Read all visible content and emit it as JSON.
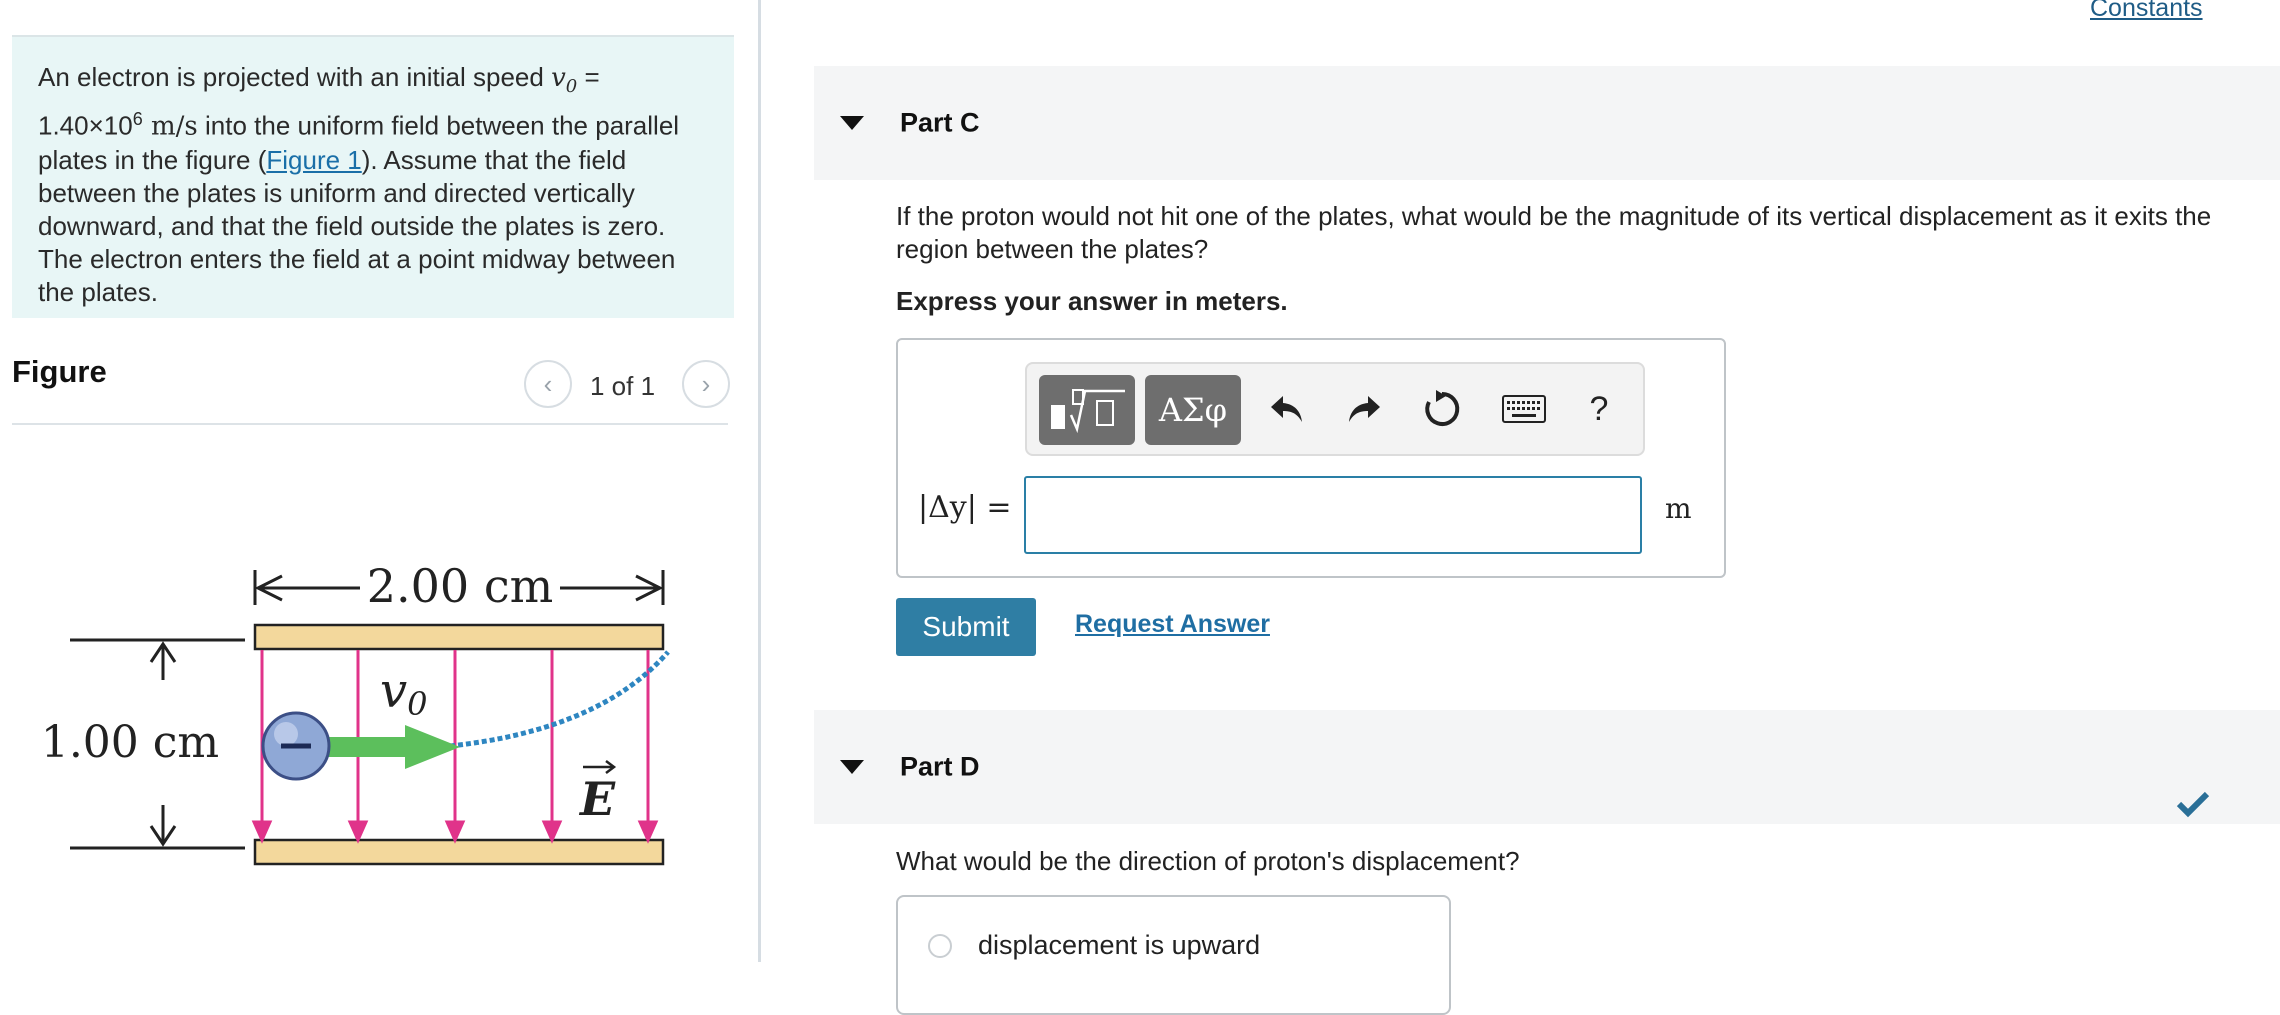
{
  "problem": {
    "text_a": "An electron is projected with an initial speed ",
    "v0_symbol": "v",
    "v0_sub": "0",
    "text_b": " = 1.40×10",
    "exp": "6",
    "unit": " m/s",
    "text_c": " into the uniform field between the parallel plates in the figure (",
    "figure_link": "Figure 1",
    "text_d": "). Assume that the field between the plates is uniform and directed vertically downward, and that the field outside the plates is zero. The electron enters the field at a point midway between the plates."
  },
  "figure": {
    "title": "Figure",
    "page_count": "1 of 1",
    "prev_icon": "chevron-left-icon",
    "next_icon": "chevron-right-icon",
    "length_label": "2.00 cm",
    "gap_label": "1.00 cm",
    "velocity_symbol": "v",
    "velocity_sub": "0",
    "field_symbol": "E",
    "colors": {
      "plate": "#f3d89c",
      "field": "#e0338a",
      "velocity": "#5cbf5c",
      "path": "#2e86c1",
      "charge": "#8fa8d6"
    }
  },
  "header": {
    "constants_link": "Constants"
  },
  "part_c": {
    "title": "Part C",
    "question": "If the proton would not hit one of the plates, what would be the magnitude of its vertical displacement as it exits the region between the plates?",
    "instruction": "Express your answer in meters.",
    "variable_label": "|Δy| =",
    "input_value": "",
    "unit": "m",
    "toolbar": {
      "templates_icon": "fraction-root-template-icon",
      "greek_label": "ΑΣφ",
      "undo_icon": "undo-icon",
      "redo_icon": "redo-icon",
      "reset_icon": "reset-icon",
      "keyboard_icon": "keyboard-icon",
      "help_label": "?"
    },
    "submit_label": "Submit",
    "request_label": "Request Answer"
  },
  "part_d": {
    "title": "Part D",
    "question": "What would be the direction of proton's displacement?",
    "choices": [
      "displacement is upward"
    ],
    "status_icon": "checkmark-icon",
    "status_color": "#2a6f97"
  }
}
